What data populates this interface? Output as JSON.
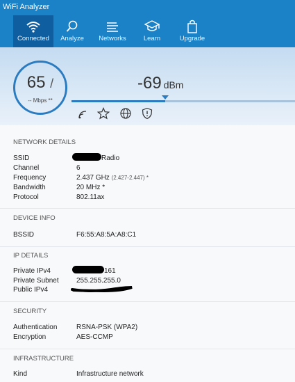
{
  "window": {
    "title": "WiFi Analyzer"
  },
  "nav": {
    "tabs": [
      {
        "label": "Connected",
        "icon": "wifi-icon",
        "active": true
      },
      {
        "label": "Analyze",
        "icon": "magnifier-icon"
      },
      {
        "label": "Networks",
        "icon": "list-icon"
      },
      {
        "label": "Learn",
        "icon": "graduation-cap-icon"
      },
      {
        "label": "Upgrade",
        "icon": "shopping-bag-icon"
      }
    ]
  },
  "hero": {
    "speed": "65",
    "speed_slash": "/",
    "speed_units": "-- Mbps **",
    "signal": "-69",
    "signal_unit": "dBm",
    "signal_level": 0.42,
    "icons": [
      "wifi-signal-icon",
      "star-icon",
      "globe-icon",
      "shield-icon"
    ]
  },
  "sections": {
    "network_details": "NETWORK DETAILS",
    "device_info": "DEVICE INFO",
    "ip_details": "IP DETAILS",
    "security": "SECURITY",
    "infrastructure": "INFRASTRUCTURE"
  },
  "network": {
    "ssid_label": "SSID",
    "ssid_value": "Radio",
    "channel_label": "Channel",
    "channel_value": "6",
    "frequency_label": "Frequency",
    "frequency_value": "2.437 GHz",
    "frequency_range": "(2.427-2.447) *",
    "bandwidth_label": "Bandwidth",
    "bandwidth_value": "20 MHz *",
    "protocol_label": "Protocol",
    "protocol_value": "802.11ax"
  },
  "device": {
    "bssid_label": "BSSID",
    "bssid_value": "F6:55:A8:5A:A8:C1"
  },
  "ip": {
    "private_ipv4_label": "Private IPv4",
    "private_ipv4_value": "161",
    "private_subnet_label": "Private Subnet",
    "private_subnet_value": "255.255.255.0",
    "public_ipv4_label": "Public IPv4"
  },
  "security": {
    "auth_label": "Authentication",
    "auth_value": "RSNA-PSK (WPA2)",
    "enc_label": "Encryption",
    "enc_value": "AES-CCMP"
  },
  "infra": {
    "kind_label": "Kind",
    "kind_value": "Infrastructure network"
  },
  "colors": {
    "accent": "#1c82c8",
    "active_tab": "#0f5ea0",
    "gauge": "#2a7bbf"
  }
}
